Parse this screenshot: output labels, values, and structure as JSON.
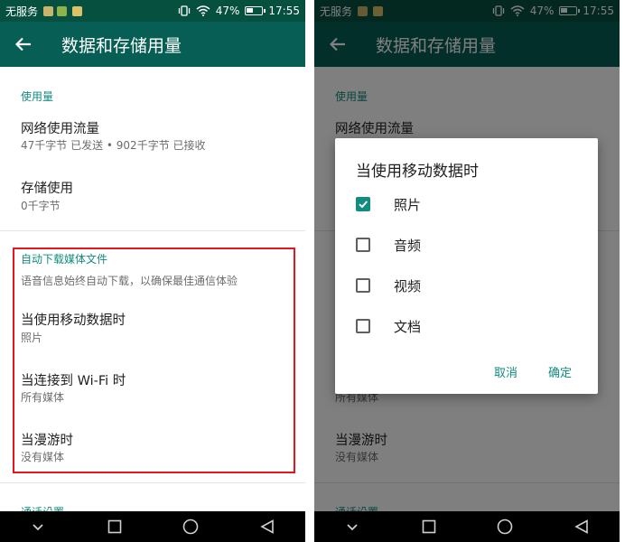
{
  "status_bar": {
    "carrier": "无服务",
    "battery": "47%",
    "battery_level": 0.47,
    "time": "17:55"
  },
  "app_bar": {
    "title": "数据和存储用量"
  },
  "usage": {
    "header": "使用量",
    "network": {
      "title": "网络使用流量",
      "subtitle": "47千字节 已发送 • 902千字节 已接收"
    },
    "storage": {
      "title": "存储使用",
      "subtitle": "0千字节"
    }
  },
  "auto_download": {
    "header": "自动下载媒体文件",
    "note": "语音信息始终自动下载，以确保最佳通信体验",
    "mobile": {
      "title": "当使用移动数据时",
      "subtitle": "照片"
    },
    "wifi": {
      "title": "当连接到 Wi-Fi 时",
      "subtitle": "所有媒体"
    },
    "roaming": {
      "title": "当漫游时",
      "subtitle": "没有媒体"
    }
  },
  "call_settings": {
    "header": "通话设置"
  },
  "dialog": {
    "title": "当使用移动数据时",
    "options": [
      {
        "label": "照片",
        "checked": true
      },
      {
        "label": "音频",
        "checked": false
      },
      {
        "label": "视频",
        "checked": false
      },
      {
        "label": "文档",
        "checked": false
      }
    ],
    "cancel": "取消",
    "ok": "确定"
  },
  "colors": {
    "accent": "#128c7e",
    "app_bar": "#075e54",
    "status_bar": "#06503f",
    "highlight": "#e8141e"
  },
  "icons": [
    "back-arrow-icon",
    "vibrate-icon",
    "wifi-icon",
    "battery-icon",
    "nav-down-icon",
    "nav-home-icon",
    "nav-recents-icon",
    "nav-back-icon",
    "checkbox-checked-icon",
    "checkbox-unchecked-icon"
  ]
}
